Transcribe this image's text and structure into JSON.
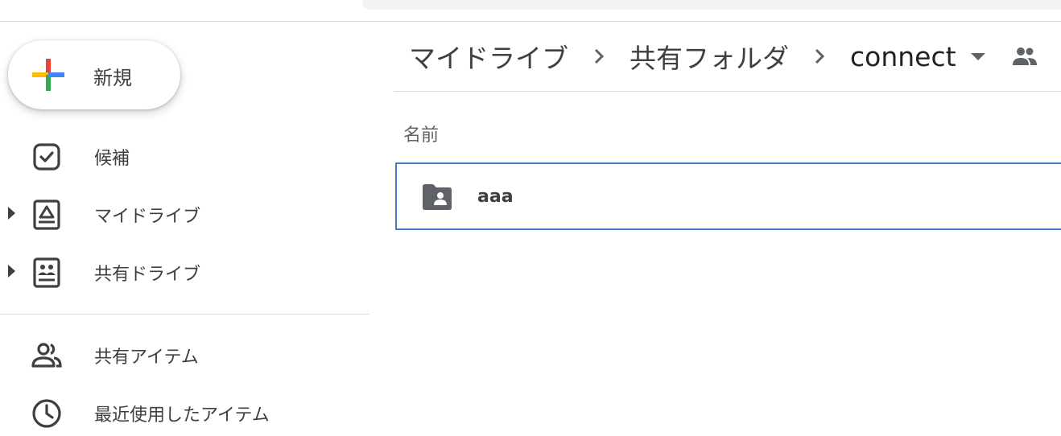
{
  "header": {
    "search_bar": ""
  },
  "new_button": {
    "label": "新規",
    "plus_colors": [
      "#ea4335",
      "#fbbc04",
      "#34a853",
      "#4285f4"
    ]
  },
  "sidebar": {
    "items": [
      {
        "label": "候補",
        "icon": "suggestions-icon",
        "expandable": false
      },
      {
        "label": "マイドライブ",
        "icon": "my-drive-icon",
        "expandable": true
      },
      {
        "label": "共有ドライブ",
        "icon": "shared-drives-icon",
        "expandable": true
      },
      {
        "label": "共有アイテム",
        "icon": "shared-with-me-icon",
        "expandable": false
      },
      {
        "label": "最近使用したアイテム",
        "icon": "recent-clock-icon",
        "expandable": false
      }
    ]
  },
  "breadcrumb": {
    "items": [
      "マイドライブ",
      "共有フォルダ"
    ],
    "current": "connect",
    "separator_icon": "chevron-right-icon",
    "dropdown_icon": "caret-down-icon",
    "shared_icon": "people-icon"
  },
  "file_list": {
    "column_header": "名前",
    "rows": [
      {
        "name": "aaa",
        "type": "shared-folder",
        "icon": "shared-folder-icon",
        "selected": true
      }
    ]
  },
  "colors": {
    "text": "#3c4043",
    "icon": "#5f6368",
    "selection_border": "#4a78c4",
    "divider": "#dadce0"
  }
}
